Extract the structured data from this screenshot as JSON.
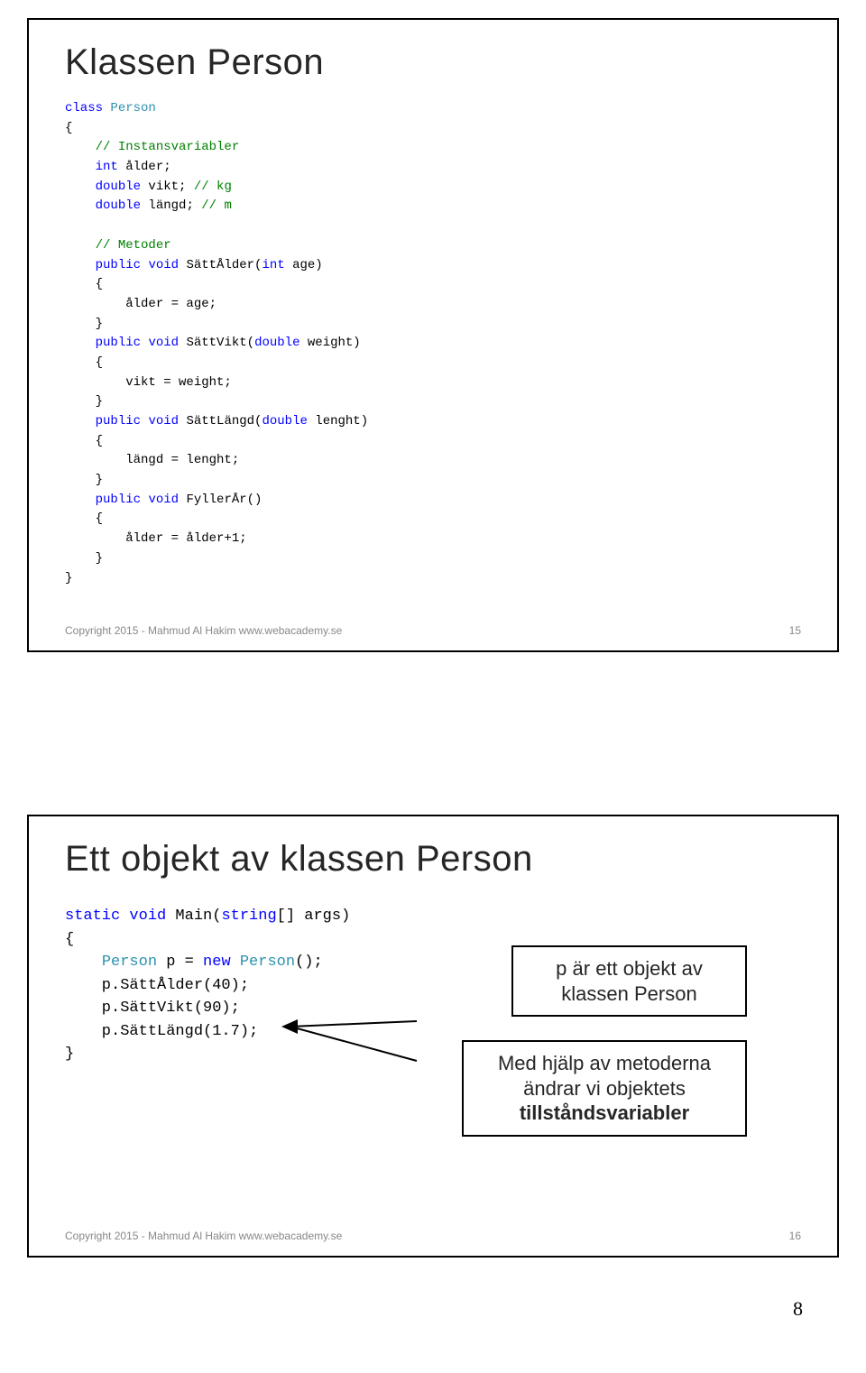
{
  "slide1": {
    "title": "Klassen Person",
    "code": {
      "l0a": "class",
      "l0b": " ",
      "l0c": "Person",
      "l1": "{",
      "l2a": "    ",
      "l2b": "// Instansvariabler",
      "l3a": "    ",
      "l3b": "int",
      "l3c": " ålder;",
      "l4a": "    ",
      "l4b": "double",
      "l4c": " vikt; ",
      "l4d": "// kg",
      "l5a": "    ",
      "l5b": "double",
      "l5c": " längd; ",
      "l5d": "// m",
      "l6": "",
      "l7a": "    ",
      "l7b": "// Metoder",
      "l8a": "    ",
      "l8b": "public",
      "l8c": " ",
      "l8d": "void",
      "l8e": " SättÅlder(",
      "l8f": "int",
      "l8g": " age)",
      "l9": "    {",
      "l10": "        ålder = age;",
      "l11": "    }",
      "l12a": "    ",
      "l12b": "public",
      "l12c": " ",
      "l12d": "void",
      "l12e": " SättVikt(",
      "l12f": "double",
      "l12g": " weight)",
      "l13": "    {",
      "l14": "        vikt = weight;",
      "l15": "    }",
      "l16a": "    ",
      "l16b": "public",
      "l16c": " ",
      "l16d": "void",
      "l16e": " SättLängd(",
      "l16f": "double",
      "l16g": " lenght)",
      "l17": "    {",
      "l18": "        längd = lenght;",
      "l19": "    }",
      "l20a": "    ",
      "l20b": "public",
      "l20c": " ",
      "l20d": "void",
      "l20e": " FyllerÅr()",
      "l21": "    {",
      "l22": "        ålder = ålder+1;",
      "l23": "    }",
      "l24": "}"
    },
    "footer_text": "Copyright 2015 - Mahmud Al Hakim www.webacademy.se",
    "footer_num": "15"
  },
  "slide2": {
    "title": "Ett objekt av klassen Person",
    "code": {
      "l0a": "static",
      "l0b": " ",
      "l0c": "void",
      "l0d": " Main(",
      "l0e": "string",
      "l0f": "[] args)",
      "l1": "{",
      "l2a": "    ",
      "l2b": "Person",
      "l2c": " p = ",
      "l2d": "new",
      "l2e": " ",
      "l2f": "Person",
      "l2g": "();",
      "l3": "    p.SättÅlder(40);",
      "l4": "    p.SättVikt(90);",
      "l5": "    p.SättLängd(1.7);",
      "l6": "}"
    },
    "callout1_l1": "p är ett objekt av",
    "callout1_l2": "klassen Person",
    "callout2_l1": "Med hjälp av metoderna",
    "callout2_l2": "ändrar vi objektets",
    "callout2_l3": "tillståndsvariabler",
    "footer_text": "Copyright 2015 - Mahmud Al Hakim www.webacademy.se",
    "footer_num": "16"
  },
  "page_number": "8"
}
